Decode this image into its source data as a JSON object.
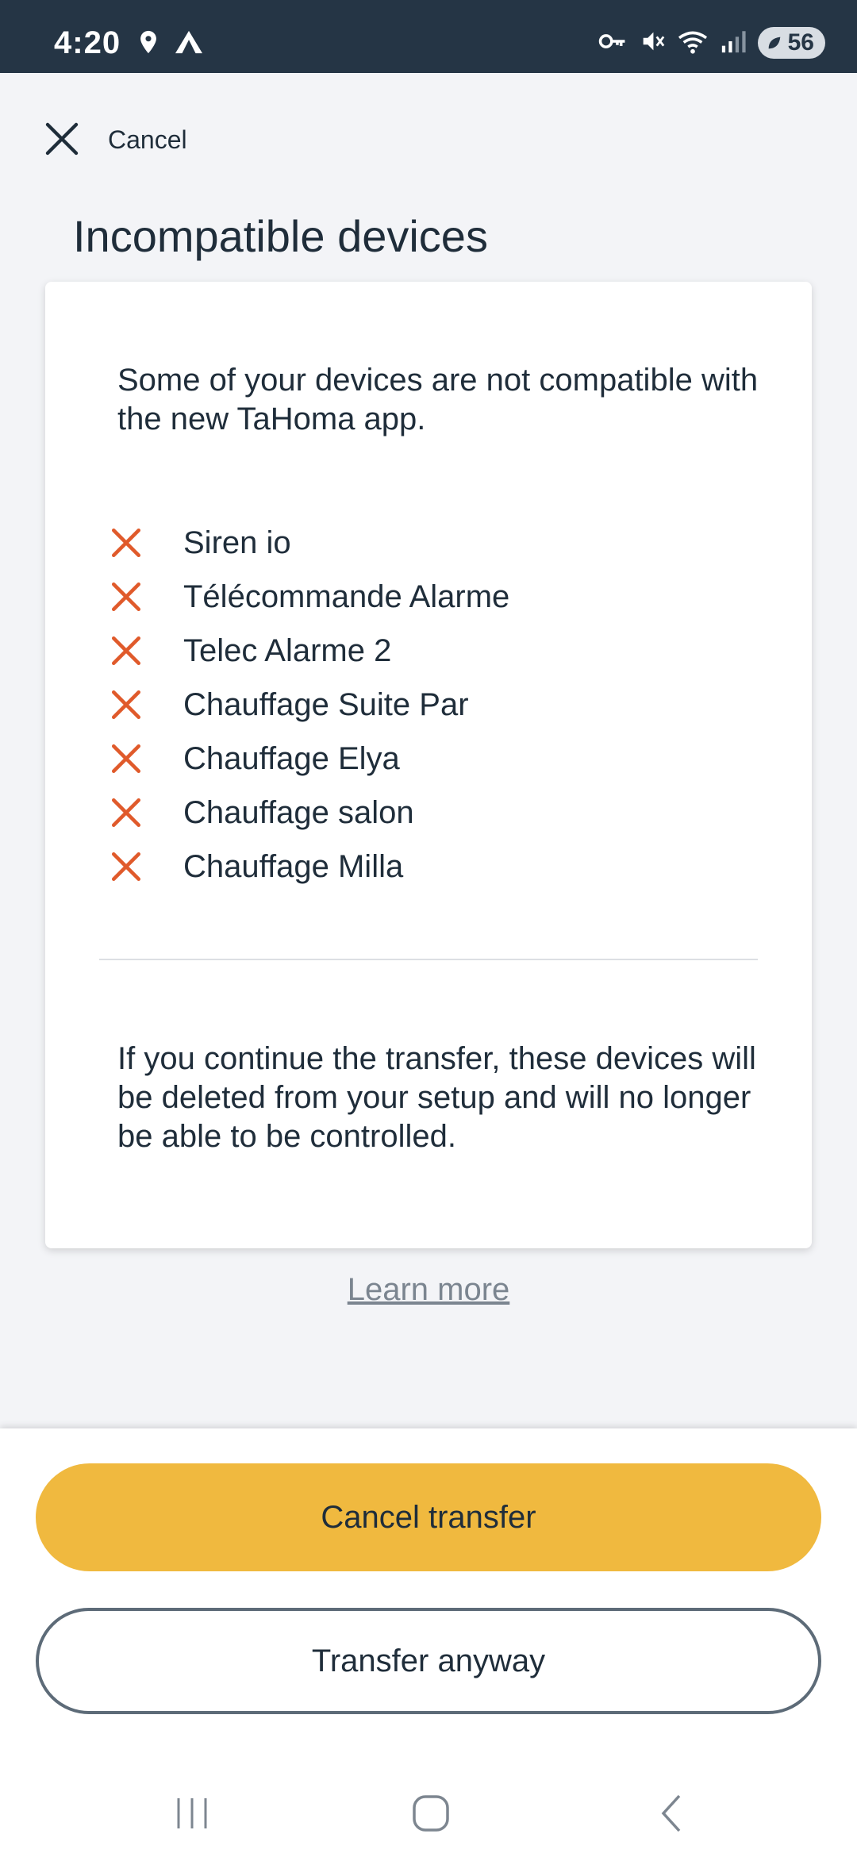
{
  "status_bar": {
    "time": "4:20",
    "battery": "56",
    "icons": [
      "location-icon",
      "nordvpn-icon",
      "key-icon",
      "mute-icon",
      "wifi-icon",
      "signal-icon",
      "battery-icon"
    ]
  },
  "header": {
    "cancel_label": "Cancel",
    "title": "Incompatible devices"
  },
  "card": {
    "intro": "Some of your devices are not compatible with the new TaHoma app.",
    "devices": [
      "Siren io",
      "Télécommande Alarme",
      "Telec Alarme 2",
      "Chauffage Suite Par",
      "Chauffage Elya",
      "Chauffage salon",
      "Chauffage Milla"
    ],
    "warning": "If you continue the transfer, these devices will be deleted from your setup and will no longer be able to be controlled."
  },
  "learn_more": "Learn more",
  "actions": {
    "primary": "Cancel transfer",
    "secondary": "Transfer anyway"
  },
  "colors": {
    "status_bar": "#253545",
    "accent": "#f0b93f",
    "error": "#e05a2b",
    "text": "#1f2d3a",
    "background": "#f3f4f7"
  }
}
